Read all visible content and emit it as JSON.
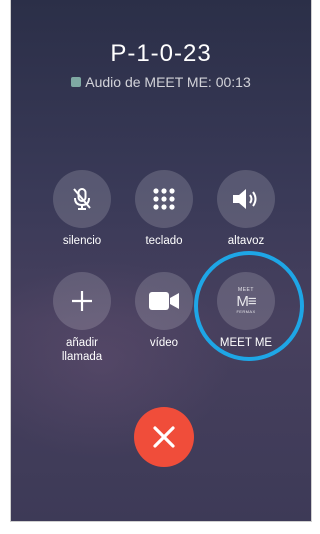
{
  "call": {
    "title": "P-1-0-23",
    "subtitle": "Audio de MEET ME: 00:13"
  },
  "buttons": {
    "mute": {
      "label": "silencio",
      "icon": "mic-off-icon"
    },
    "keypad": {
      "label": "teclado",
      "icon": "keypad-icon"
    },
    "speaker": {
      "label": "altavoz",
      "icon": "speaker-icon"
    },
    "add_call": {
      "label_line1": "añadir",
      "label_line2": "llamada",
      "icon": "plus-icon"
    },
    "video": {
      "label": "vídeo",
      "icon": "video-camera-icon"
    },
    "meet_me": {
      "label": "MEET ME",
      "icon": "meet-me-logo-icon"
    }
  },
  "end_call": {
    "icon": "close-icon"
  },
  "colors": {
    "highlight_ring": "#1ea6e6",
    "end_call": "#f04d3a",
    "button_bg": "rgba(255,255,255,0.16)"
  }
}
